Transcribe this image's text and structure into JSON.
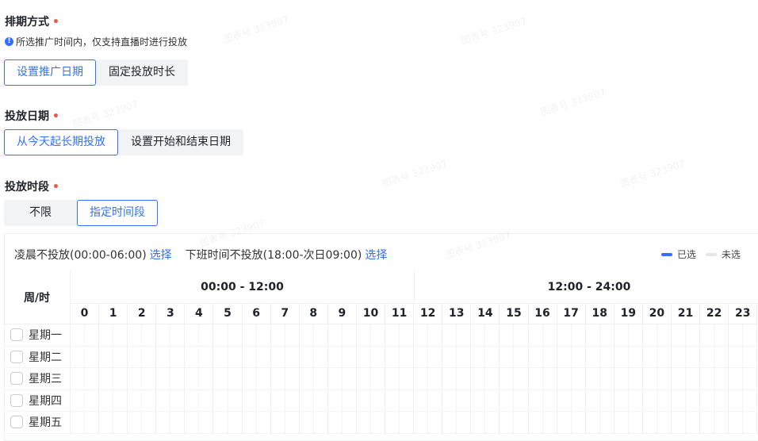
{
  "schedule": {
    "title": "排期方式",
    "required_mark": "•",
    "hint": "所选推广时间内，仅支持直播时进行投放",
    "options": [
      "设置推广日期",
      "固定投放时长"
    ],
    "selected": "设置推广日期"
  },
  "dates": {
    "title": "投放日期",
    "required_mark": "•",
    "options": [
      "从今天起长期投放",
      "设置开始和结束日期"
    ],
    "selected": "从今天起长期投放"
  },
  "period": {
    "title": "投放时段",
    "required_mark": "•",
    "options": [
      "不限",
      "指定时间段"
    ],
    "selected": "指定时间段"
  },
  "quick": {
    "item1": "凌晨不投放(00:00-06:00)",
    "item1_link": "选择",
    "item2": "下班时间不投放(18:00-次日09:00)",
    "item2_link": "选择"
  },
  "legend": {
    "selected": "已选",
    "unselected": "未选"
  },
  "grid": {
    "corner": "周/时",
    "half_a": "00:00 - 12:00",
    "half_b": "12:00 - 24:00",
    "hours": [
      "0",
      "1",
      "2",
      "3",
      "4",
      "5",
      "6",
      "7",
      "8",
      "9",
      "10",
      "11",
      "12",
      "13",
      "14",
      "15",
      "16",
      "17",
      "18",
      "19",
      "20",
      "21",
      "22",
      "23"
    ],
    "days": [
      "星期一",
      "星期二",
      "星期三",
      "星期四",
      "星期五"
    ]
  },
  "colors": {
    "accent": "#3370ff",
    "required": "#e8594d"
  },
  "watermark": "图表号 323907"
}
